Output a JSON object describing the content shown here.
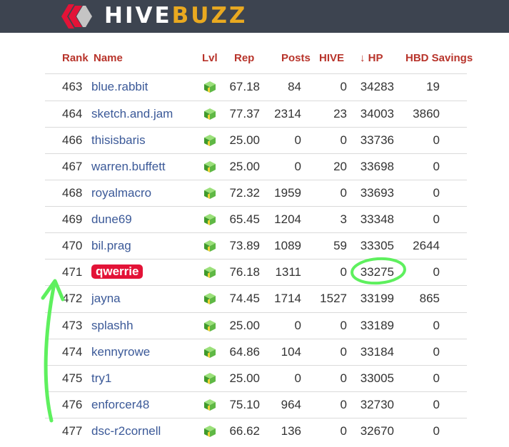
{
  "app": {
    "brand_part1": "HIVE",
    "brand_part2": "BUZZ",
    "brand_color": "#e9a920",
    "header_bg": "#3d4450"
  },
  "columns": {
    "rank": "Rank",
    "name": "Name",
    "lvl": "Lvl",
    "rep": "Rep",
    "posts": "Posts",
    "hive": "HIVE",
    "sort_arrow": "↓",
    "hp": "HP",
    "hbd": "HBD Savings"
  },
  "icons": {
    "level": "green-cube-icon",
    "logo": "hive-logo-icon"
  },
  "colors": {
    "header_text": "#b8342b",
    "name_link": "#3b5998",
    "highlight_badge": "#e31337",
    "annotation": "#5ef05e"
  },
  "rows": [
    {
      "rank": "463",
      "name": "blue.rabbit",
      "rep": "67.18",
      "posts": "84",
      "hive": "0",
      "hp": "34283",
      "hbd": "19"
    },
    {
      "rank": "464",
      "name": "sketch.and.jam",
      "rep": "77.37",
      "posts": "2314",
      "hive": "23",
      "hp": "34003",
      "hbd": "3860"
    },
    {
      "rank": "466",
      "name": "thisisbaris",
      "rep": "25.00",
      "posts": "0",
      "hive": "0",
      "hp": "33736",
      "hbd": "0"
    },
    {
      "rank": "467",
      "name": "warren.buffett",
      "rep": "25.00",
      "posts": "0",
      "hive": "20",
      "hp": "33698",
      "hbd": "0"
    },
    {
      "rank": "468",
      "name": "royalmacro",
      "rep": "72.32",
      "posts": "1959",
      "hive": "0",
      "hp": "33693",
      "hbd": "0"
    },
    {
      "rank": "469",
      "name": "dune69",
      "rep": "65.45",
      "posts": "1204",
      "hive": "3",
      "hp": "33348",
      "hbd": "0"
    },
    {
      "rank": "470",
      "name": "bil.prag",
      "rep": "73.89",
      "posts": "1089",
      "hive": "59",
      "hp": "33305",
      "hbd": "2644"
    },
    {
      "rank": "471",
      "name": "qwerrie",
      "rep": "76.18",
      "posts": "1311",
      "hive": "0",
      "hp": "33275",
      "hbd": "0",
      "highlighted": true
    },
    {
      "rank": "472",
      "name": "jayna",
      "rep": "74.45",
      "posts": "1714",
      "hive": "1527",
      "hp": "33199",
      "hbd": "865"
    },
    {
      "rank": "473",
      "name": "splashh",
      "rep": "25.00",
      "posts": "0",
      "hive": "0",
      "hp": "33189",
      "hbd": "0"
    },
    {
      "rank": "474",
      "name": "kennyrowe",
      "rep": "64.86",
      "posts": "104",
      "hive": "0",
      "hp": "33184",
      "hbd": "0"
    },
    {
      "rank": "475",
      "name": "try1",
      "rep": "25.00",
      "posts": "0",
      "hive": "0",
      "hp": "33005",
      "hbd": "0"
    },
    {
      "rank": "476",
      "name": "enforcer48",
      "rep": "75.10",
      "posts": "964",
      "hive": "0",
      "hp": "32730",
      "hbd": "0"
    },
    {
      "rank": "477",
      "name": "dsc-r2cornell",
      "rep": "66.62",
      "posts": "136",
      "hive": "0",
      "hp": "32670",
      "hbd": "0"
    }
  ]
}
